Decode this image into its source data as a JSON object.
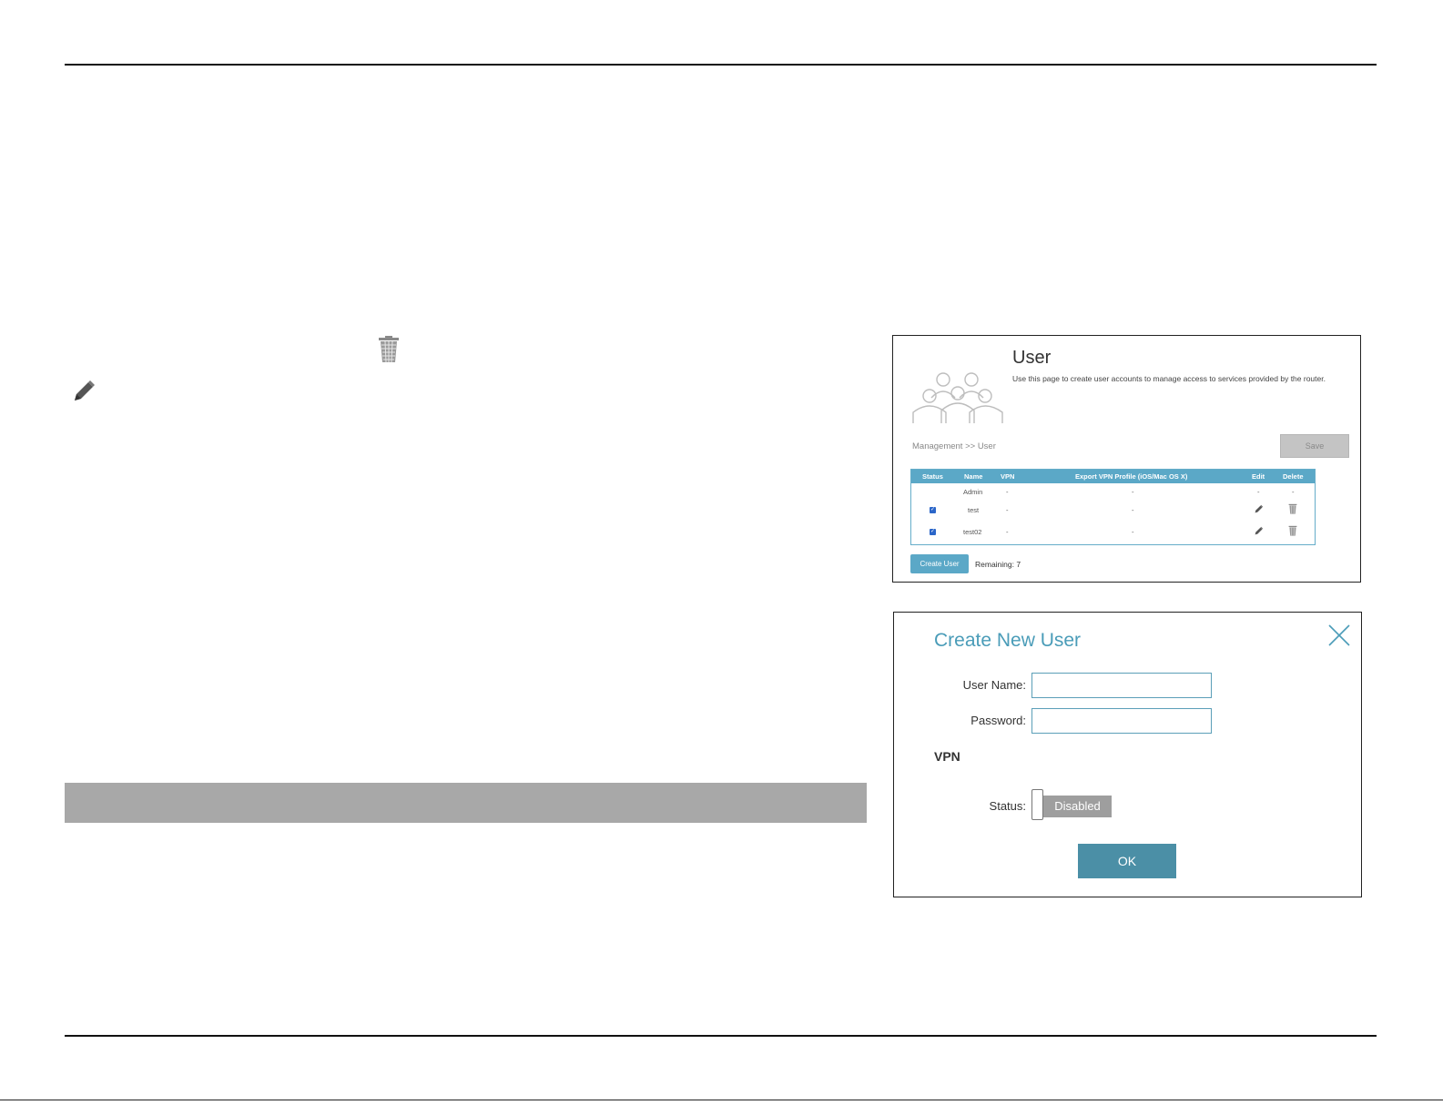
{
  "icons": {
    "inline_trash": "trash-icon",
    "inline_pencil": "pencil-icon",
    "users_group": "users-group-icon",
    "close": "close-icon"
  },
  "user_page": {
    "title": "User",
    "description": "Use this page to create user accounts to manage access to services provided by the router.",
    "breadcrumb": "Management >> User",
    "save_label": "Save",
    "table": {
      "headers": [
        "Status",
        "Name",
        "VPN",
        "Export VPN Profile (iOS/Mac OS X)",
        "Edit",
        "Delete"
      ],
      "rows": [
        {
          "checked": false,
          "name": "Admin",
          "vpn": "-",
          "export": "-",
          "edit": "-",
          "delete": "-"
        },
        {
          "checked": true,
          "name": "test",
          "vpn": "-",
          "export": "-",
          "edit": "pencil-icon",
          "delete": "trash-icon"
        },
        {
          "checked": true,
          "name": "test02",
          "vpn": "-",
          "export": "-",
          "edit": "pencil-icon",
          "delete": "trash-icon"
        }
      ]
    },
    "create_user_label": "Create User",
    "remaining": "Remaining: 7"
  },
  "create_dialog": {
    "title": "Create New User",
    "username_label": "User Name:",
    "username_value": "",
    "password_label": "Password:",
    "password_value": "",
    "vpn_heading": "VPN",
    "status_label": "Status:",
    "status_value": "Disabled",
    "ok_label": "OK"
  },
  "colors": {
    "accent": "#5ba8c7",
    "dialog_title": "#4a9cb8",
    "ok_button": "#4b8fa6",
    "band_grey": "#a8a8a8",
    "toggle_off": "#9e9e9e"
  }
}
